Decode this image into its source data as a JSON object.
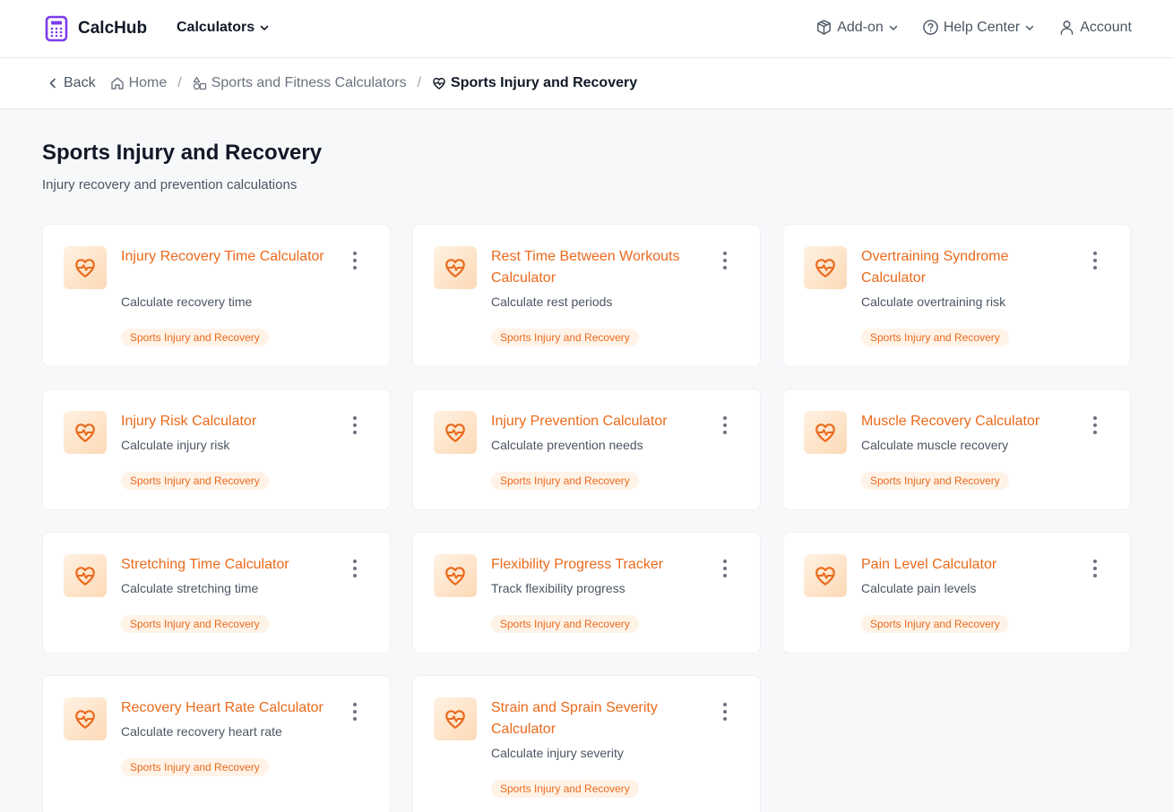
{
  "app": {
    "name": "CalcHub"
  },
  "topnav": {
    "calculators": "Calculators",
    "addon": "Add-on",
    "help": "Help Center",
    "account": "Account"
  },
  "breadcrumb": {
    "back": "Back",
    "home": "Home",
    "parent": "Sports and Fitness Calculators",
    "current": "Sports Injury and Recovery"
  },
  "page": {
    "title": "Sports Injury and Recovery",
    "subtitle": "Injury recovery and prevention calculations"
  },
  "colors": {
    "accent": "#ea6a1c",
    "logo": "#7c3aed"
  },
  "cards": [
    {
      "title": "Injury Recovery Time Calculator",
      "desc": "Calculate recovery time",
      "tag": "Sports Injury and Recovery",
      "icon": "heart-pulse-icon"
    },
    {
      "title": "Rest Time Between Workouts Calculator",
      "desc": "Calculate rest periods",
      "tag": "Sports Injury and Recovery",
      "icon": "heart-pulse-icon"
    },
    {
      "title": "Overtraining Syndrome Calculator",
      "desc": "Calculate overtraining risk",
      "tag": "Sports Injury and Recovery",
      "icon": "heart-pulse-icon"
    },
    {
      "title": "Injury Risk Calculator",
      "desc": "Calculate injury risk",
      "tag": "Sports Injury and Recovery",
      "icon": "heart-pulse-icon"
    },
    {
      "title": "Injury Prevention Calculator",
      "desc": "Calculate prevention needs",
      "tag": "Sports Injury and Recovery",
      "icon": "heart-pulse-icon"
    },
    {
      "title": "Muscle Recovery Calculator",
      "desc": "Calculate muscle recovery",
      "tag": "Sports Injury and Recovery",
      "icon": "heart-pulse-icon"
    },
    {
      "title": "Stretching Time Calculator",
      "desc": "Calculate stretching time",
      "tag": "Sports Injury and Recovery",
      "icon": "heart-pulse-icon"
    },
    {
      "title": "Flexibility Progress Tracker",
      "desc": "Track flexibility progress",
      "tag": "Sports Injury and Recovery",
      "icon": "heart-pulse-icon"
    },
    {
      "title": "Pain Level Calculator",
      "desc": "Calculate pain levels",
      "tag": "Sports Injury and Recovery",
      "icon": "heart-pulse-icon"
    },
    {
      "title": "Recovery Heart Rate Calculator",
      "desc": "Calculate recovery heart rate",
      "tag": "Sports Injury and Recovery",
      "icon": "heart-pulse-icon"
    },
    {
      "title": "Strain and Sprain Severity Calculator",
      "desc": "Calculate injury severity",
      "tag": "Sports Injury and Recovery",
      "icon": "heart-pulse-icon"
    }
  ]
}
